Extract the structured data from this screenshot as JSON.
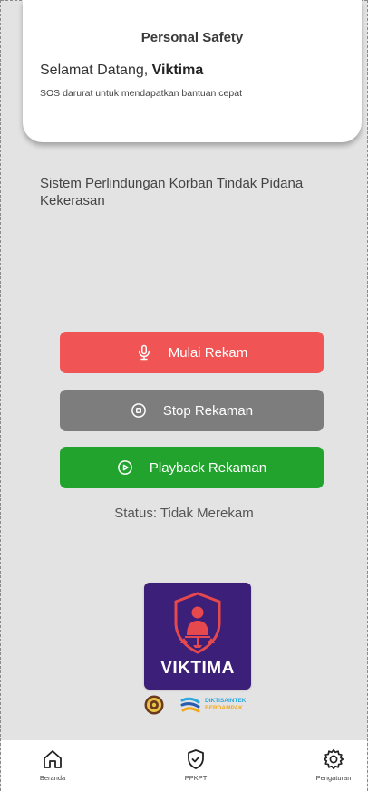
{
  "header": {
    "title": "Personal Safety",
    "greeting_prefix": "Selamat Datang, ",
    "user_name": "Viktima",
    "subtitle": "SOS darurat untuk mendapatkan bantuan cepat"
  },
  "main": {
    "system_description": "Sistem Perlindungan Korban Tindak Pidana Kekerasan",
    "buttons": {
      "start_record": {
        "label": "Mulai Rekam",
        "icon": "microphone-icon",
        "color": "#f05454"
      },
      "stop_record": {
        "label": "Stop Rekaman",
        "icon": "stop-circle-icon",
        "color": "#7d7d7d"
      },
      "playback": {
        "label": "Playback Rekaman",
        "icon": "play-circle-icon",
        "color": "#21a32d"
      }
    },
    "status": "Status: Tidak Merekam"
  },
  "branding": {
    "logo_word": "VIKTIMA",
    "logo_color": "#3b1f78",
    "partner_line1": "DIKTISAINTEK",
    "partner_line2": "BERDAMPAK"
  },
  "bottom_nav": {
    "items": [
      {
        "label": "Beranda",
        "icon": "home-icon"
      },
      {
        "label": "PPKPT",
        "icon": "shield-check-icon"
      },
      {
        "label": "Pengaturan",
        "icon": "gear-icon"
      }
    ]
  }
}
